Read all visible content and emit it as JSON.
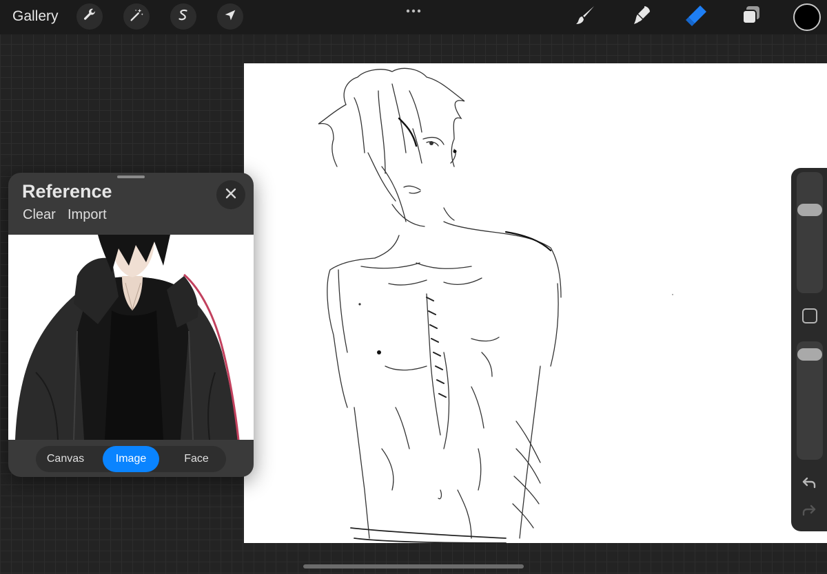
{
  "topbar": {
    "gallery_label": "Gallery",
    "left_tools": [
      {
        "name": "wrench-icon",
        "label": "Actions"
      },
      {
        "name": "magic-wand-icon",
        "label": "Adjustments"
      },
      {
        "name": "selection-icon",
        "label": "Selection"
      },
      {
        "name": "transform-arrow-icon",
        "label": "Transform"
      }
    ],
    "right_tools": [
      {
        "name": "brush-icon",
        "active": false
      },
      {
        "name": "smudge-icon",
        "active": false
      },
      {
        "name": "eraser-icon",
        "active": true
      },
      {
        "name": "layers-icon",
        "active": false
      }
    ],
    "current_color": "#000000",
    "active_tool_color": "#1e7ff5"
  },
  "reference": {
    "title": "Reference",
    "clear_label": "Clear",
    "import_label": "Import",
    "modes": [
      {
        "label": "Canvas",
        "active": false
      },
      {
        "label": "Image",
        "active": true
      },
      {
        "label": "Face",
        "active": false
      }
    ],
    "accent_color": "#0a84ff"
  },
  "sidebar": {
    "brush_size_level": 0.72,
    "opacity_level": 0.96
  }
}
